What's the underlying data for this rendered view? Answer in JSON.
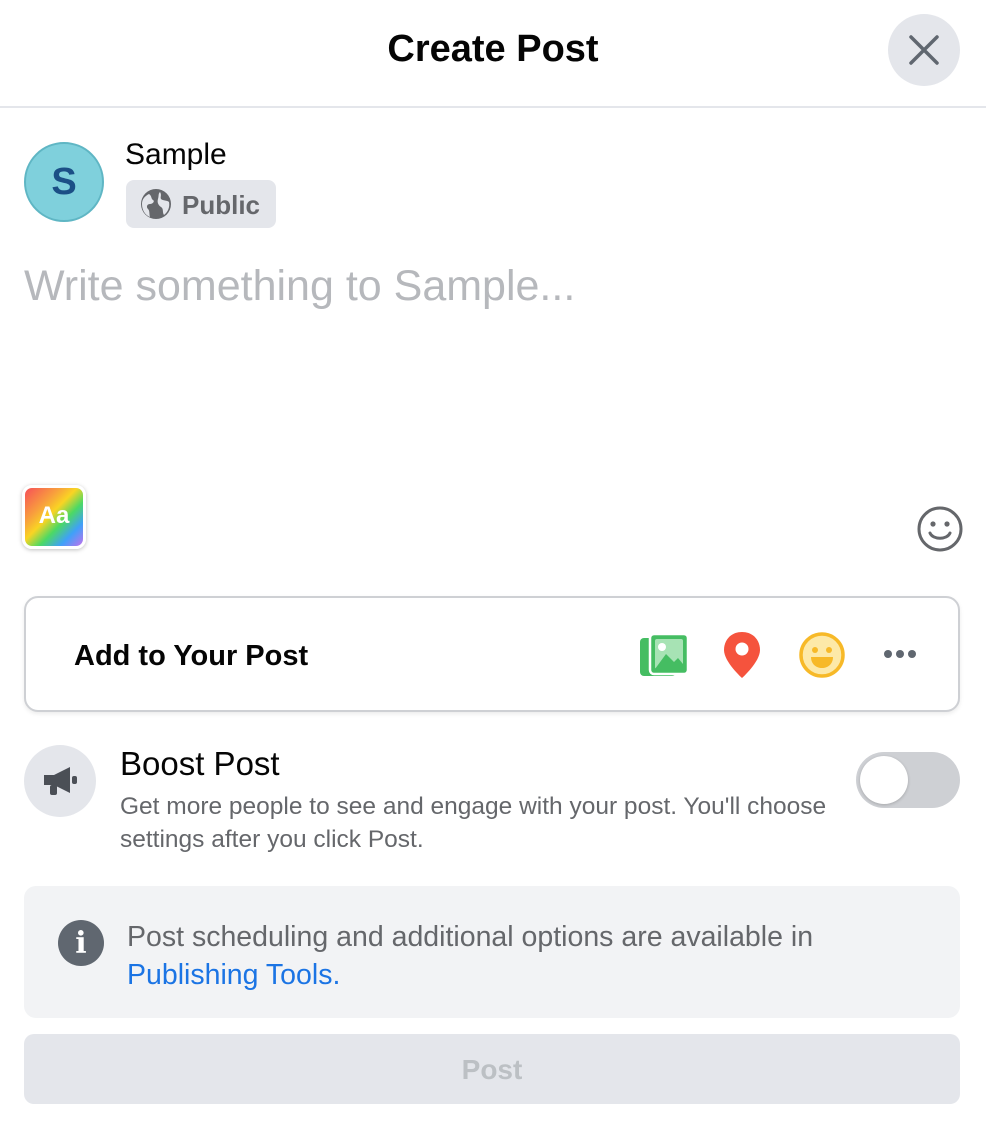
{
  "header": {
    "title": "Create Post",
    "close_icon": "close-icon"
  },
  "author": {
    "avatar_initial": "S",
    "name": "Sample",
    "audience_label": "Public",
    "audience_icon": "globe-icon"
  },
  "composer": {
    "placeholder": "Write something to Sample...",
    "value": ""
  },
  "composer_tools": {
    "background_label": "Aa",
    "emoji_icon": "smiley-outline-icon"
  },
  "add_to_post": {
    "label": "Add to Your Post",
    "items": [
      {
        "icon": "photo-video-icon",
        "color": "#45bd62"
      },
      {
        "icon": "location-pin-icon",
        "color": "#f5533d"
      },
      {
        "icon": "feeling-smiley-icon",
        "color": "#f7b928"
      },
      {
        "icon": "more-horizontal-icon",
        "color": "#606770"
      }
    ]
  },
  "boost": {
    "title": "Boost Post",
    "description": "Get more people to see and engage with your post. You'll choose settings after you click Post.",
    "icon": "megaphone-icon",
    "enabled": false
  },
  "info": {
    "text": "Post scheduling and additional options are available in",
    "link_text": "Publishing Tools.",
    "icon": "info-icon"
  },
  "post_button": {
    "label": "Post",
    "disabled": true
  },
  "colors": {
    "link": "#1b74e4",
    "secondary_text": "#65676b",
    "divider": "#e4e6eb",
    "avatar_bg": "#7fd0dc"
  }
}
